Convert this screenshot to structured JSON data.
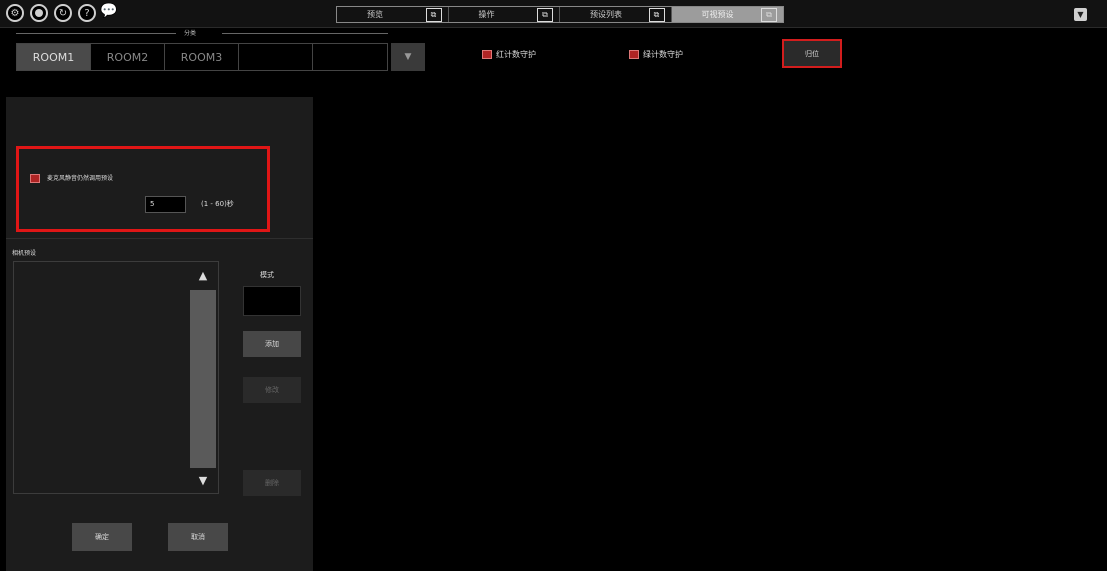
{
  "topbar": {
    "icons": [
      {
        "name": "settings-icon",
        "glyph": "⚙"
      },
      {
        "name": "camera-icon",
        "glyph": ""
      },
      {
        "name": "sync-icon",
        "glyph": "↻"
      },
      {
        "name": "help-icon",
        "glyph": "?"
      },
      {
        "name": "chat-icon",
        "glyph": "💬"
      }
    ],
    "tabs": [
      {
        "label": "预览",
        "active": false
      },
      {
        "label": "操作",
        "active": false
      },
      {
        "label": "预设列表",
        "active": false
      },
      {
        "label": "可视预设",
        "active": true
      }
    ],
    "popout_glyph": "⧉",
    "menu_glyph": "▼"
  },
  "rooms": {
    "group_label": "分类",
    "items": [
      "ROOM1",
      "ROOM2",
      "ROOM3",
      "",
      ""
    ],
    "active_index": 0,
    "dropdown_glyph": "▼"
  },
  "guards": {
    "red_counter": "红计数守护",
    "green_counter": "绿计数守护",
    "reset_label": "归位"
  },
  "settings": {
    "checkbox_label": "麦克风静音仍然调用预设",
    "value": "5",
    "range": "(1 - 60)秒"
  },
  "presets": {
    "section_label": "相机预设",
    "mode_label": "模式",
    "add_label": "添加",
    "edit_label": "修改",
    "delete_label": "删除",
    "scroll_up": "▲",
    "scroll_down": "▼"
  },
  "footer": {
    "ok_label": "确定",
    "cancel_label": "取消"
  },
  "colors": {
    "accent_red": "#e01616",
    "checkbox_red": "#b02424",
    "active_tab": "#9c9c9c"
  }
}
